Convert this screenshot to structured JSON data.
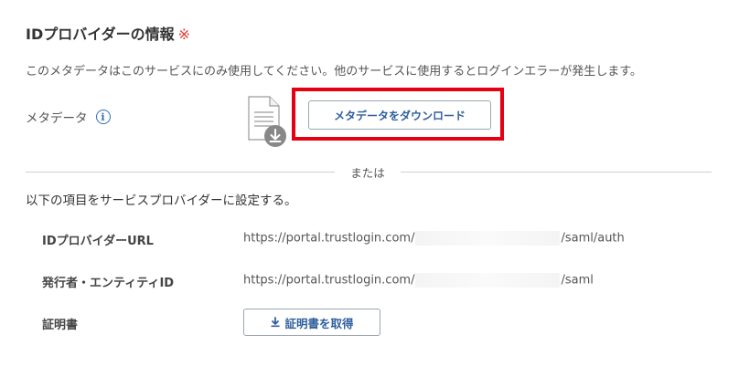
{
  "section": {
    "title": "IDプロバイダーの情報",
    "required_mark": "※",
    "notice": "このメタデータはこのサービスにのみ使用してください。他のサービスに使用するとログインエラーが発生します。"
  },
  "metadata": {
    "label": "メタデータ",
    "info_icon": "i",
    "download_button": "メタデータをダウンロード"
  },
  "divider": {
    "text": "または"
  },
  "instruction": "以下の項目をサービスプロバイダーに設定する。",
  "fields": {
    "idp_url": {
      "label": "IDプロバイダーURL",
      "prefix": "https://portal.trustlogin.com/",
      "suffix": "/saml/auth"
    },
    "issuer": {
      "label": "発行者・エンティティID",
      "prefix": "https://portal.trustlogin.com/",
      "suffix": "/saml"
    },
    "certificate": {
      "label": "証明書",
      "button": "証明書を取得"
    }
  },
  "colors": {
    "accent": "#2f5f9e",
    "highlight": "#e60012",
    "required": "#e53935"
  }
}
